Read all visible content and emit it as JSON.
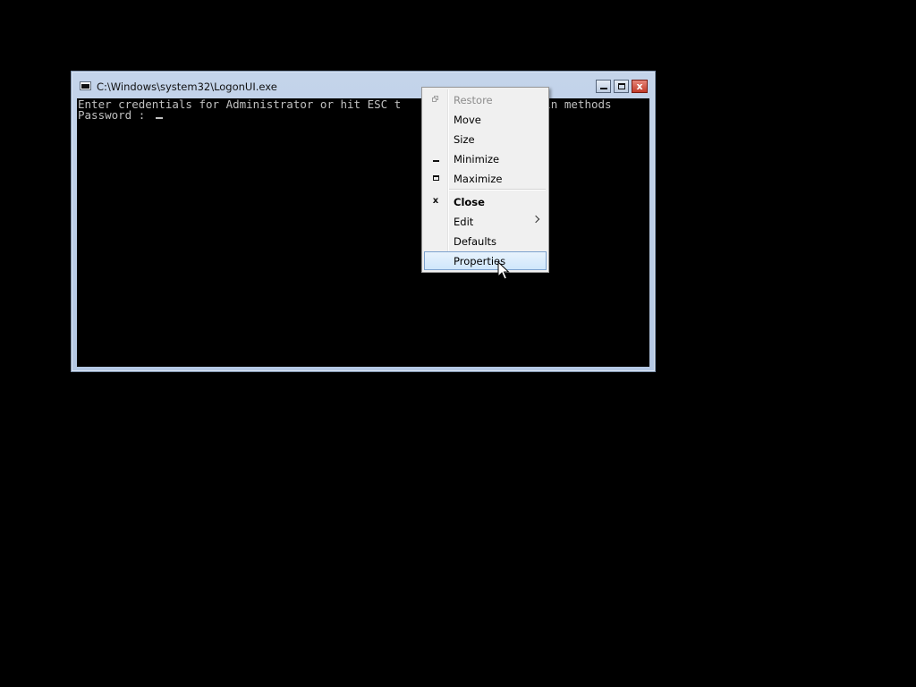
{
  "window": {
    "title": "C:\\Windows\\system32\\LogonUI.exe",
    "icon": "console-window-icon",
    "buttons": {
      "minimize": "minimize-icon",
      "maximize": "maximize-icon",
      "close": "x"
    }
  },
  "console": {
    "line1": "Enter credentials for Administrator or hit ESC t",
    "line1_tail": "n-in methods",
    "line2": "Password : "
  },
  "system_menu": {
    "items": [
      {
        "label": "Restore",
        "icon": "restore-icon",
        "enabled": false
      },
      {
        "label": "Move",
        "icon": "",
        "enabled": true
      },
      {
        "label": "Size",
        "icon": "",
        "enabled": true
      },
      {
        "label": "Minimize",
        "icon": "minimize-icon",
        "enabled": true
      },
      {
        "label": "Maximize",
        "icon": "maximize-icon",
        "enabled": true
      },
      {
        "label": "Close",
        "icon": "close-icon",
        "enabled": true,
        "bold": true,
        "icon_glyph": "x"
      },
      {
        "label": "Edit",
        "icon": "",
        "enabled": true,
        "submenu": true
      },
      {
        "label": "Defaults",
        "icon": "",
        "enabled": true
      },
      {
        "label": "Properties",
        "icon": "",
        "enabled": true,
        "highlighted": true
      }
    ]
  },
  "colors": {
    "desktop": "#000000",
    "frame": "#b9cbe4",
    "console_bg": "#000000",
    "console_text": "#c0c0c0",
    "close_button": "#c7402e",
    "menu_bg": "#f0f0f0",
    "menu_highlight": "#d6eafc"
  }
}
